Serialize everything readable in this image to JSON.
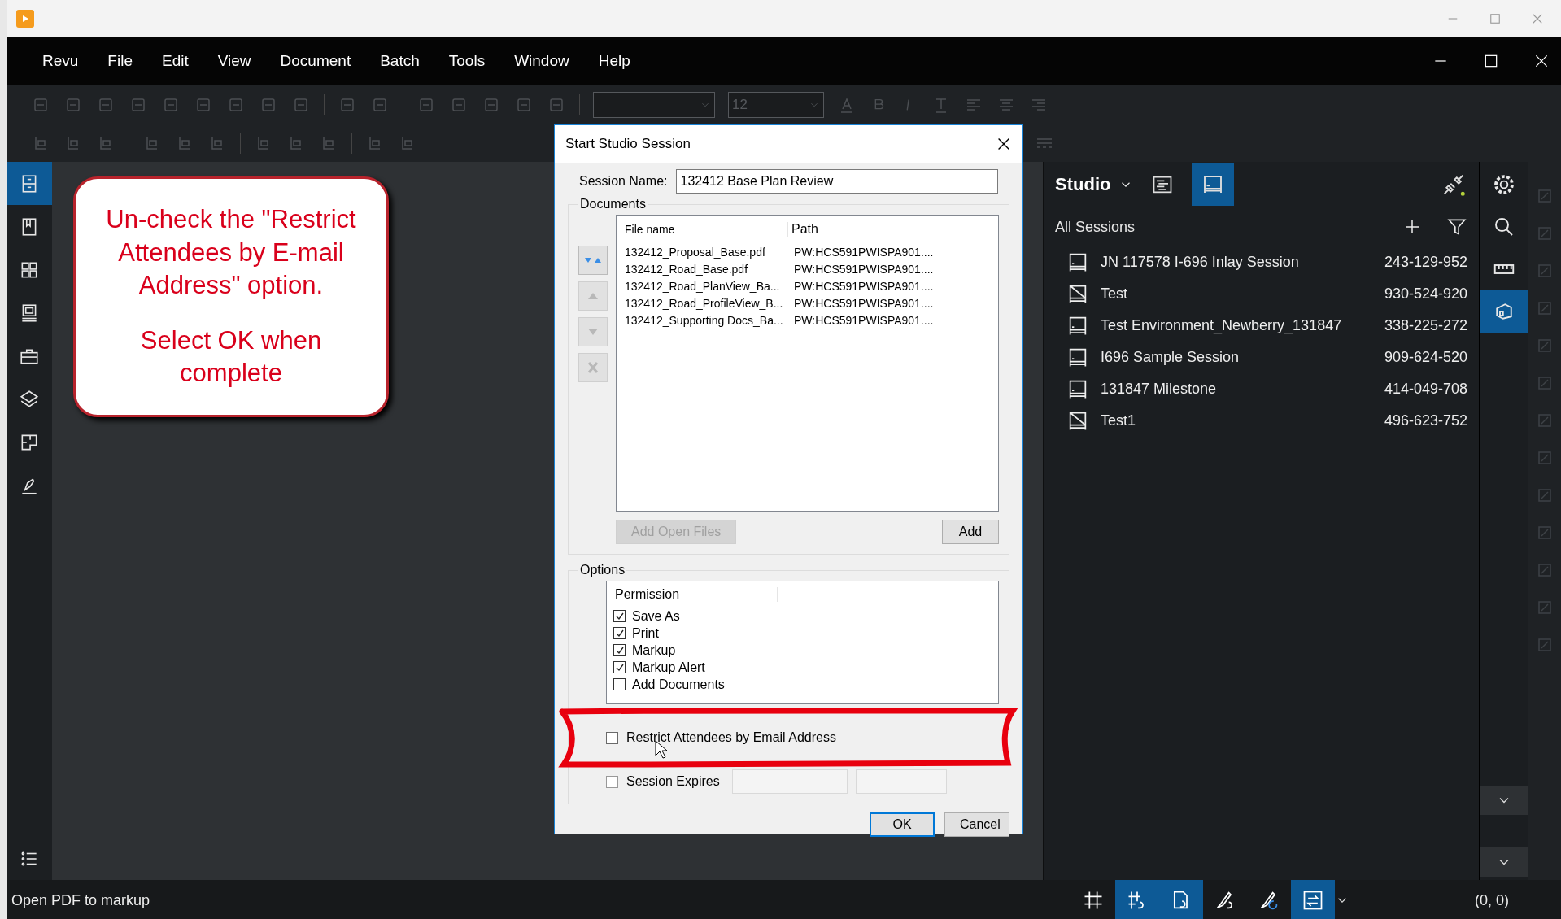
{
  "menu": [
    "Revu",
    "File",
    "Edit",
    "View",
    "Document",
    "Batch",
    "Tools",
    "Window",
    "Help"
  ],
  "toolbar": {
    "font_size": "12"
  },
  "left_sidebar": [
    {
      "kind": "cabinet",
      "selected": true
    },
    {
      "kind": "bookmark",
      "selected": false
    },
    {
      "kind": "thumbnails",
      "selected": false
    },
    {
      "kind": "stack",
      "selected": false
    },
    {
      "kind": "toolbox",
      "selected": false
    },
    {
      "kind": "layers",
      "selected": false
    },
    {
      "kind": "spaces",
      "selected": false
    },
    {
      "kind": "signature",
      "selected": false
    },
    {
      "kind": "list",
      "selected": false
    }
  ],
  "callout": {
    "paragraphs": [
      "Un-check the \"Restrict Attendees by E-mail Address\" option.",
      "Select OK when complete"
    ]
  },
  "dialog": {
    "title": "Start Studio Session",
    "session_name_label": "Session Name:",
    "session_name_value": "132412 Base Plan Review",
    "documents": {
      "legend": "Documents",
      "columns": [
        "File name",
        "Path"
      ],
      "rows": [
        {
          "file": "132412_Proposal_Base.pdf",
          "path": "PW:HCS591PWISPA901...."
        },
        {
          "file": "132412_Road_Base.pdf",
          "path": "PW:HCS591PWISPA901...."
        },
        {
          "file": "132412_Road_PlanView_Ba...",
          "path": "PW:HCS591PWISPA901...."
        },
        {
          "file": "132412_Road_ProfileView_B...",
          "path": "PW:HCS591PWISPA901...."
        },
        {
          "file": "132412_Supporting Docs_Ba...",
          "path": "PW:HCS591PWISPA901...."
        }
      ],
      "side_buttons": [
        {
          "kind": "sort",
          "disabled": false
        },
        {
          "kind": "up",
          "disabled": true
        },
        {
          "kind": "down",
          "disabled": true
        },
        {
          "kind": "remove",
          "disabled": true
        }
      ],
      "buttons": [
        {
          "label": "Add Open Files",
          "disabled": true
        },
        {
          "label": "Add",
          "disabled": false
        }
      ]
    },
    "options": {
      "legend": "Options",
      "permission_header": "Permission",
      "permissions": [
        {
          "label": "Save As",
          "checked": true
        },
        {
          "label": "Print",
          "checked": true
        },
        {
          "label": "Markup",
          "checked": true
        },
        {
          "label": "Markup Alert",
          "checked": true
        },
        {
          "label": "Add Documents",
          "checked": false
        }
      ],
      "restrict": {
        "label": "Restrict Attendees by Email Address",
        "checked": false
      },
      "session_expires": {
        "label": "Session Expires",
        "checked": false
      }
    },
    "buttons": [
      {
        "label": "OK",
        "default": true
      },
      {
        "label": "Cancel",
        "default": false
      }
    ]
  },
  "studio": {
    "title": "Studio",
    "section": "All Sessions",
    "sessions": [
      {
        "name": "JN 117578 I-696 Inlay Session",
        "id": "243-129-952",
        "kind": "plain"
      },
      {
        "name": "Test",
        "id": "930-524-920",
        "kind": "crossed"
      },
      {
        "name": "Test Environment_Newberry_131847",
        "id": "338-225-272",
        "kind": "plain"
      },
      {
        "name": "I696 Sample Session",
        "id": "909-624-520",
        "kind": "plain"
      },
      {
        "name": "131847 Milestone",
        "id": "414-049-708",
        "kind": "plain"
      },
      {
        "name": "Test1",
        "id": "496-623-752",
        "kind": "crossed"
      }
    ]
  },
  "right_toolbar": [
    {
      "kind": "gear",
      "selected": false
    },
    {
      "kind": "search",
      "selected": false
    },
    {
      "kind": "ruler",
      "selected": false
    },
    {
      "kind": "studio",
      "selected": true
    }
  ],
  "status_bar": {
    "text": "Open PDF to markup",
    "coordinates": "(0, 0)",
    "tools": [
      {
        "kind": "grid",
        "selected": false
      },
      {
        "kind": "grid-sync",
        "selected": true
      },
      {
        "kind": "page-sync",
        "selected": true
      },
      {
        "kind": "markup-sync",
        "selected": false
      },
      {
        "kind": "markup-refresh",
        "selected": false
      },
      {
        "kind": "swap",
        "selected": true
      }
    ]
  }
}
